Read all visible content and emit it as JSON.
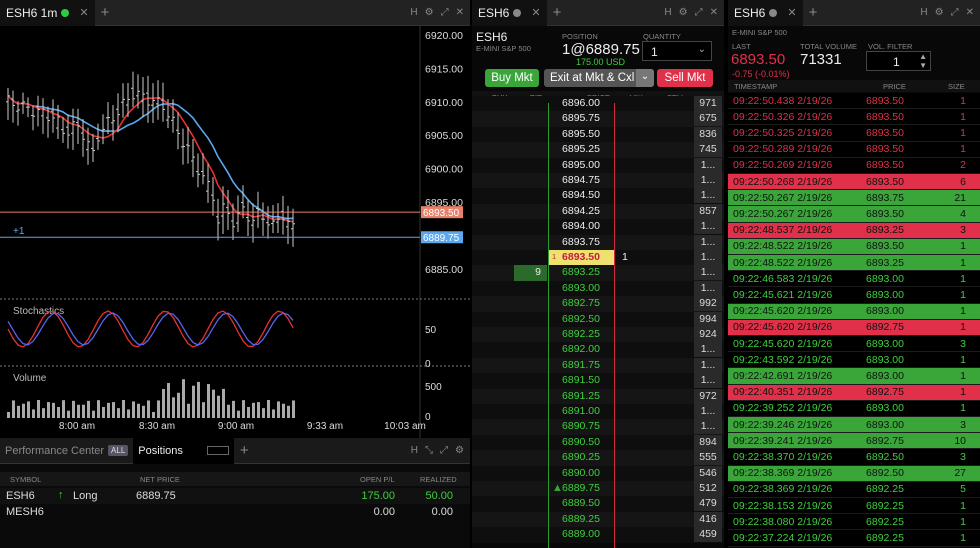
{
  "chart": {
    "tab_label": "ESH6 1m",
    "price_labels": [
      "6920.00",
      "6915.00",
      "6910.00",
      "6905.00",
      "6900.00",
      "6895.00",
      "6890.00",
      "6885.00"
    ],
    "current_marker": "6893.50",
    "position_marker": "6889.75",
    "position_qty": "+1",
    "stoch_label": "Stochastics",
    "stoch_ticks": [
      "50",
      "0"
    ],
    "volume_label": "Volume",
    "volume_ticks": [
      "500",
      "0"
    ],
    "time_labels": [
      "8:00 am",
      "8:30 am",
      "9:00 am",
      "9:33 am",
      "10:03 am"
    ]
  },
  "perf": {
    "tab1": "Performance Center",
    "all_badge": "ALL",
    "tab2": "Positions",
    "columns": [
      "SYMBOL",
      "NET PRICE",
      "OPEN P/L",
      "REALIZED"
    ],
    "rows": [
      {
        "symbol": "ESH6",
        "side": "Long",
        "net": "6889.75",
        "open": "175.00",
        "realized": "50.00"
      },
      {
        "symbol": "MESH6",
        "side": "",
        "net": "",
        "open": "0.00",
        "realized": "0.00"
      }
    ]
  },
  "dom": {
    "tab_label": "ESH6",
    "symbol": "ESH6",
    "desc": "E-MINI S&P 500",
    "position_label": "POSITION",
    "position_value": "1@6889.75",
    "position_pl": "175.00 USD",
    "quantity_label": "QUANTITY",
    "quantity_value": "1",
    "buy_label": "Buy Mkt",
    "exit_label": "Exit at Mkt & Cxl",
    "sell_label": "Sell Mkt",
    "columns": [
      "BUY",
      "BID",
      "PRICE",
      "ASK",
      "SELL"
    ],
    "colors": {
      "buy": "#3aa63a",
      "sell": "#e0304a",
      "exit": "#555"
    },
    "ladder": [
      {
        "price": "6896.00",
        "vol": "971"
      },
      {
        "price": "6895.75",
        "vol": "675"
      },
      {
        "price": "6895.50",
        "vol": "836"
      },
      {
        "price": "6895.25",
        "vol": "745"
      },
      {
        "price": "6895.00",
        "vol": "1..."
      },
      {
        "price": "6894.75",
        "vol": "1..."
      },
      {
        "price": "6894.50",
        "vol": "1..."
      },
      {
        "price": "6894.25",
        "vol": "857"
      },
      {
        "price": "6894.00",
        "vol": "1..."
      },
      {
        "price": "6893.75",
        "vol": "1..."
      },
      {
        "price": "6893.50",
        "vol": "1...",
        "last": "1",
        "ask": "1"
      },
      {
        "price": "6893.25",
        "vol": "1...",
        "bid": "9"
      },
      {
        "price": "6893.00",
        "vol": "1..."
      },
      {
        "price": "6892.75",
        "vol": "992"
      },
      {
        "price": "6892.50",
        "vol": "994"
      },
      {
        "price": "6892.25",
        "vol": "924"
      },
      {
        "price": "6892.00",
        "vol": "1..."
      },
      {
        "price": "6891.75",
        "vol": "1..."
      },
      {
        "price": "6891.50",
        "vol": "1..."
      },
      {
        "price": "6891.25",
        "vol": "972"
      },
      {
        "price": "6891.00",
        "vol": "1..."
      },
      {
        "price": "6890.75",
        "vol": "1..."
      },
      {
        "price": "6890.50",
        "vol": "894"
      },
      {
        "price": "6890.25",
        "vol": "555"
      },
      {
        "price": "6890.00",
        "vol": "546"
      },
      {
        "price": "6889.75",
        "vol": "512",
        "mark": "1"
      },
      {
        "price": "6889.50",
        "vol": "479"
      },
      {
        "price": "6889.25",
        "vol": "416"
      },
      {
        "price": "6889.00",
        "vol": "459"
      }
    ]
  },
  "ts": {
    "tab_label": "ESH6",
    "desc": "E-MINI S&P 500",
    "last_label": "LAST",
    "last_value": "6893.50",
    "last_change": "-0.75 (-0.01%)",
    "volume_label": "TOTAL VOLUME",
    "volume_value": "71331",
    "filter_label": "VOL. FILTER",
    "filter_value": "1",
    "columns": [
      "TIMESTAMP",
      "PRICE",
      "SIZE"
    ],
    "rows": [
      {
        "t": "09:22:50.438 2/19/26",
        "p": "6893.50",
        "s": "1",
        "c": "r"
      },
      {
        "t": "09:22:50.326 2/19/26",
        "p": "6893.50",
        "s": "1",
        "c": "r"
      },
      {
        "t": "09:22:50.325 2/19/26",
        "p": "6893.50",
        "s": "1",
        "c": "r"
      },
      {
        "t": "09:22:50.289 2/19/26",
        "p": "6893.50",
        "s": "1",
        "c": "r"
      },
      {
        "t": "09:22:50.269 2/19/26",
        "p": "6893.50",
        "s": "2",
        "c": "r"
      },
      {
        "t": "09:22:50.268 2/19/26",
        "p": "6893.50",
        "s": "6",
        "c": "R"
      },
      {
        "t": "09:22:50.267 2/19/26",
        "p": "6893.75",
        "s": "21",
        "c": "G"
      },
      {
        "t": "09:22:50.267 2/19/26",
        "p": "6893.50",
        "s": "4",
        "c": "G"
      },
      {
        "t": "09:22:48.537 2/19/26",
        "p": "6893.25",
        "s": "3",
        "c": "R"
      },
      {
        "t": "09:22:48.522 2/19/26",
        "p": "6893.50",
        "s": "1",
        "c": "G"
      },
      {
        "t": "09:22:48.522 2/19/26",
        "p": "6893.25",
        "s": "1",
        "c": "G"
      },
      {
        "t": "09:22:46.583 2/19/26",
        "p": "6893.00",
        "s": "1",
        "c": "g"
      },
      {
        "t": "09:22:45.621 2/19/26",
        "p": "6893.00",
        "s": "1",
        "c": "g"
      },
      {
        "t": "09:22:45.620 2/19/26",
        "p": "6893.00",
        "s": "1",
        "c": "G"
      },
      {
        "t": "09:22:45.620 2/19/26",
        "p": "6892.75",
        "s": "1",
        "c": "R"
      },
      {
        "t": "09:22:45.620 2/19/26",
        "p": "6893.00",
        "s": "3",
        "c": "g"
      },
      {
        "t": "09:22:43.592 2/19/26",
        "p": "6893.00",
        "s": "1",
        "c": "g"
      },
      {
        "t": "09:22:42.691 2/19/26",
        "p": "6893.00",
        "s": "1",
        "c": "G"
      },
      {
        "t": "09:22:40.351 2/19/26",
        "p": "6892.75",
        "s": "1",
        "c": "R"
      },
      {
        "t": "09:22:39.252 2/19/26",
        "p": "6893.00",
        "s": "1",
        "c": "g"
      },
      {
        "t": "09:22:39.246 2/19/26",
        "p": "6893.00",
        "s": "3",
        "c": "G"
      },
      {
        "t": "09:22:39.241 2/19/26",
        "p": "6892.75",
        "s": "10",
        "c": "G"
      },
      {
        "t": "09:22:38.370 2/19/26",
        "p": "6892.50",
        "s": "3",
        "c": "g"
      },
      {
        "t": "09:22:38.369 2/19/26",
        "p": "6892.50",
        "s": "27",
        "c": "G"
      },
      {
        "t": "09:22:38.369 2/19/26",
        "p": "6892.25",
        "s": "5",
        "c": "g"
      },
      {
        "t": "09:22:38.153 2/19/26",
        "p": "6892.25",
        "s": "1",
        "c": "g"
      },
      {
        "t": "09:22:38.080 2/19/26",
        "p": "6892.25",
        "s": "1",
        "c": "g"
      },
      {
        "t": "09:22:37.224 2/19/26",
        "p": "6892.25",
        "s": "1",
        "c": "g"
      }
    ]
  }
}
